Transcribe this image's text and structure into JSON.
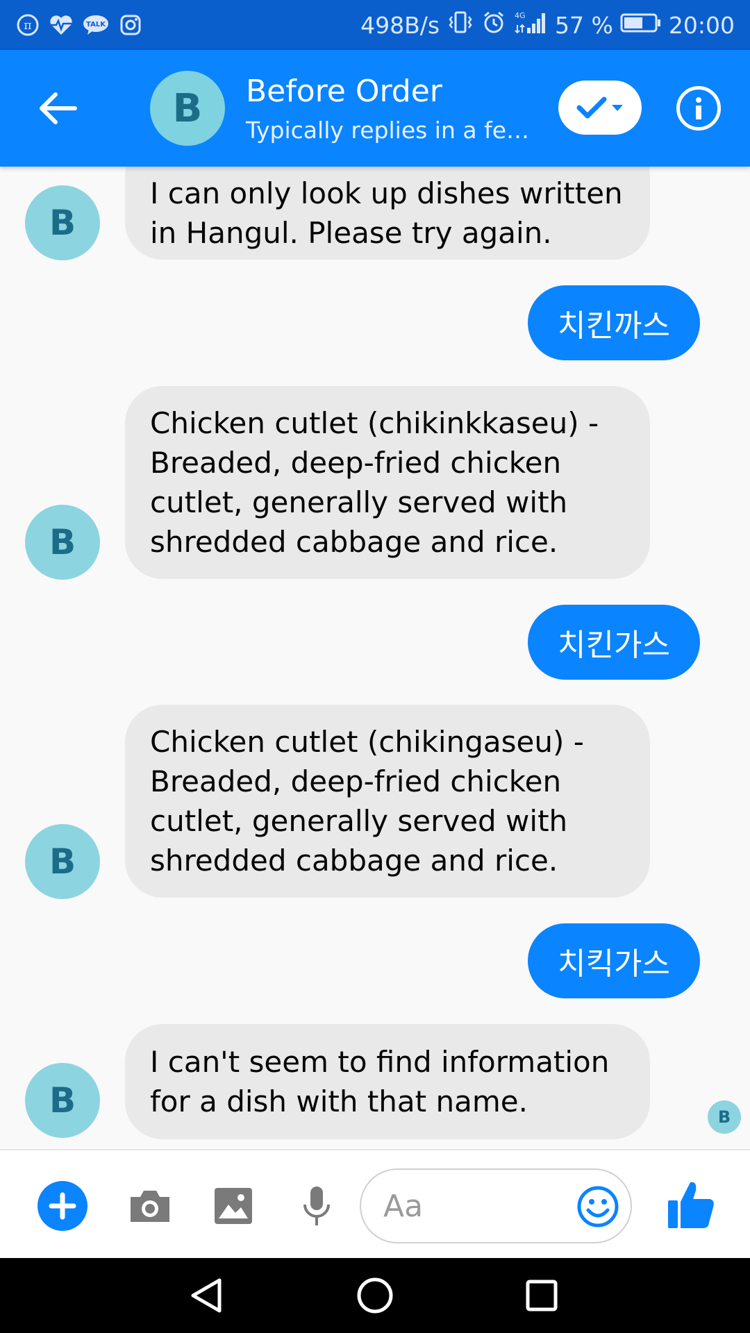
{
  "status_bar": {
    "net_speed": "498B/s",
    "network": "4G",
    "battery": "57 %",
    "time": "20:00",
    "left_icons": [
      "pi-icon",
      "heart-pulse-icon",
      "talk-icon",
      "instagram-icon"
    ],
    "talk_label": "TALK"
  },
  "header": {
    "avatar_letter": "B",
    "title": "Before Order",
    "subtitle": "Typically replies in a fe…",
    "icons": [
      "back-arrow-icon",
      "check-dropdown-icon",
      "info-icon"
    ],
    "accent_color": "#0a84ff"
  },
  "messages": [
    {
      "side": "in",
      "avatar": "B",
      "text": "I can only look up dishes written in Hangul. Please try again."
    },
    {
      "side": "out",
      "text": "치킨까스"
    },
    {
      "side": "in",
      "avatar": "B",
      "text": "Chicken cutlet (chikinkkaseu) - Breaded, deep-fried chicken cutlet, generally served with shredded cabbage and rice."
    },
    {
      "side": "out",
      "text": "치킨가스"
    },
    {
      "side": "in",
      "avatar": "B",
      "text": "Chicken cutlet (chikingaseu) - Breaded, deep-fried chicken cutlet, generally served with shredded cabbage and rice."
    },
    {
      "side": "out",
      "text": "치킥가스"
    },
    {
      "side": "in",
      "avatar": "B",
      "text": "I can't seem to find information for a dish with that name."
    }
  ],
  "read_receipt": "B",
  "composer": {
    "placeholder": "Aa",
    "icons": [
      "plus-icon",
      "camera-icon",
      "image-icon",
      "microphone-icon",
      "emoji-icon",
      "thumbs-up-icon"
    ]
  },
  "nav_bar": {
    "icons": [
      "back-triangle-icon",
      "home-circle-icon",
      "recents-square-icon"
    ]
  }
}
